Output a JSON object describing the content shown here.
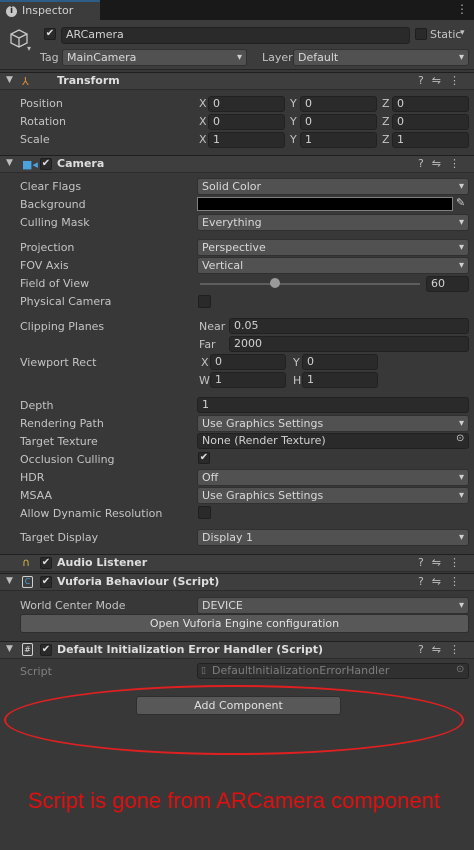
{
  "tab": {
    "title": "Inspector"
  },
  "object": {
    "name": "ARCamera",
    "static_label": "Static",
    "tag_label": "Tag",
    "tag_value": "MainCamera",
    "layer_label": "Layer",
    "layer_value": "Default"
  },
  "transform": {
    "title": "Transform",
    "rows": [
      {
        "label": "Position",
        "x": "0",
        "y": "0",
        "z": "0"
      },
      {
        "label": "Rotation",
        "x": "0",
        "y": "0",
        "z": "0"
      },
      {
        "label": "Scale",
        "x": "1",
        "y": "1",
        "z": "1"
      }
    ],
    "axes": {
      "x": "X",
      "y": "Y",
      "z": "Z"
    }
  },
  "camera": {
    "title": "Camera",
    "clear_flags_label": "Clear Flags",
    "clear_flags_value": "Solid Color",
    "background_label": "Background",
    "background_color": "#000000",
    "culling_mask_label": "Culling Mask",
    "culling_mask_value": "Everything",
    "projection_label": "Projection",
    "projection_value": "Perspective",
    "fov_axis_label": "FOV Axis",
    "fov_axis_value": "Vertical",
    "fov_label": "Field of View",
    "fov_value": "60",
    "fov_fraction": 0.34,
    "physical_camera_label": "Physical Camera",
    "clipping_label": "Clipping Planes",
    "near_label": "Near",
    "near_value": "0.05",
    "far_label": "Far",
    "far_value": "2000",
    "viewport_label": "Viewport Rect",
    "vp_x_label": "X",
    "vp_x_value": "0",
    "vp_y_label": "Y",
    "vp_y_value": "0",
    "vp_w_label": "W",
    "vp_w_value": "1",
    "vp_h_label": "H",
    "vp_h_value": "1",
    "depth_label": "Depth",
    "depth_value": "1",
    "rendering_path_label": "Rendering Path",
    "rendering_path_value": "Use Graphics Settings",
    "target_texture_label": "Target Texture",
    "target_texture_value": "None (Render Texture)",
    "occlusion_label": "Occlusion Culling",
    "hdr_label": "HDR",
    "hdr_value": "Off",
    "msaa_label": "MSAA",
    "msaa_value": "Use Graphics Settings",
    "dynres_label": "Allow Dynamic Resolution",
    "target_display_label": "Target Display",
    "target_display_value": "Display 1"
  },
  "audio_listener": {
    "title": "Audio Listener"
  },
  "vuforia": {
    "title": "Vuforia Behaviour (Script)",
    "world_center_label": "World Center Mode",
    "world_center_value": "DEVICE",
    "open_config_button": "Open Vuforia Engine configuration"
  },
  "init_handler": {
    "title": "Default Initialization Error Handler (Script)",
    "script_label": "Script",
    "script_value": "DefaultInitializationErrorHandler"
  },
  "add_component_button": "Add Component",
  "annotation": {
    "text": "Script is gone from ARCamera component",
    "color": "#e01010"
  }
}
